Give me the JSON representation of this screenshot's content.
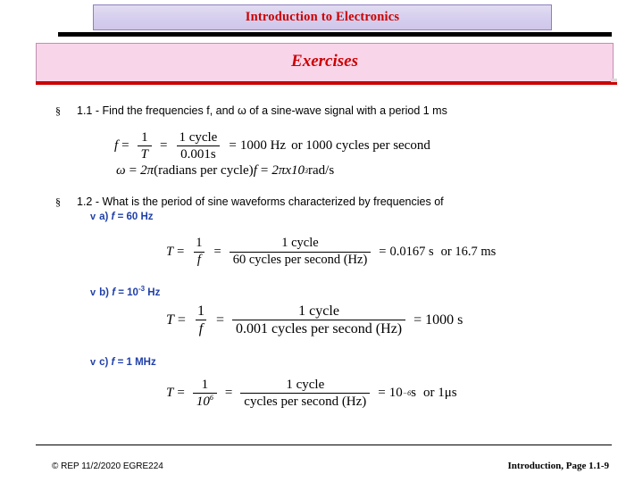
{
  "header": {
    "title": "Introduction to Electronics",
    "section_title": "Exercises"
  },
  "colors": {
    "title_text": "#cc0000",
    "title_band": "#d7cfee",
    "section_band": "#f9d5ea",
    "rule_red": "#cc0000",
    "bullet_blue": "#1f3fa8"
  },
  "bullets": {
    "b1_marker": "§",
    "b1_text": "1.1 - Find the frequencies f, and ω of a sine-wave signal with a period 1 ms",
    "b2_marker": "§",
    "b2_text": "1.2 - What is the period of sine waveforms characterized by frequencies of",
    "sub_a_marker": "v",
    "sub_a_text_pre": "a) ",
    "sub_a_var": "f",
    "sub_a_text_post": " = 60 Hz",
    "sub_b_marker": "v",
    "sub_b_text_pre": "b) ",
    "sub_b_var": "f",
    "sub_b_text_post": " = 10",
    "sub_b_exp": "-3",
    "sub_b_unit": " Hz",
    "sub_c_marker": "v",
    "sub_c_text_pre": "c) ",
    "sub_c_var": "f",
    "sub_c_text_post": " = 1 MHz"
  },
  "equations": {
    "eq1": {
      "lhs": "f",
      "eq1_sign": "=",
      "frac1_num": "1",
      "frac1_den": "T",
      "eq2_sign": "=",
      "frac2_num": "1 cycle",
      "frac2_den": "0.001s",
      "eq3_sign": "=",
      "rhs": "1000 Hz",
      "alt": "or 1000 cycles per second"
    },
    "eq2": {
      "lhs": "ω",
      "eq1_sign": "=",
      "mid": "2π",
      "paren": "(radians per cycle)",
      "var": "f",
      "eq2_sign": "=",
      "rhs": "2πx10",
      "exp": "3",
      "unit": " rad/s"
    },
    "eq_a": {
      "lhs": "T",
      "eq1_sign": "=",
      "frac1_num": "1",
      "frac1_den": "f",
      "eq2_sign": "=",
      "frac2_num": "1 cycle",
      "frac2_den": "60 cycles per second (Hz)",
      "eq3_sign": "=",
      "rhs": "0.0167 s",
      "alt": "or 16.7 ms"
    },
    "eq_b": {
      "lhs": "T",
      "eq1_sign": "=",
      "frac1_num": "1",
      "frac1_den": "f",
      "eq2_sign": "=",
      "frac2_num": "1 cycle",
      "frac2_den": "0.001 cycles per second (Hz)",
      "eq3_sign": "=",
      "rhs": "1000 s"
    },
    "eq_c": {
      "lhs": "T",
      "eq1_sign": "=",
      "frac1_num": "1",
      "frac1_den": "10",
      "frac1_den_exp": "6",
      "frac2_num": "1 cycle",
      "frac2_den": "cycles per second (Hz)",
      "eq2_sign": "=",
      "eq3_sign": "=",
      "rhs": "10",
      "rhs_exp": "−6",
      "rhs_unit": " s",
      "alt": "or 1μs"
    }
  },
  "footer": {
    "left": "© REP  11/2/2020  EGRE224",
    "right": "Introduction, Page 1.1-9"
  }
}
